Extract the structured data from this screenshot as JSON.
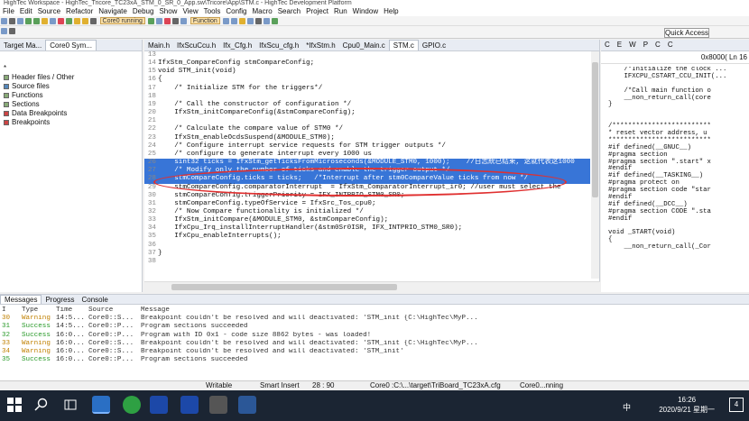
{
  "window": {
    "title": "HighTec Workspace - HighTec_Tricore_TC23xA_STM_0_SR_0_App.sw\\Tricore\\App\\STM.c - HighTec Development Platform"
  },
  "menu": [
    "File",
    "Edit",
    "Source",
    "Refactor",
    "Navigate",
    "Debug",
    "Show",
    "View",
    "Tools",
    "Config",
    "Macro",
    "Search",
    "Project",
    "Run",
    "Window",
    "Help"
  ],
  "toolbar": {
    "run_state": "Core0 running",
    "function_label": "Function"
  },
  "quick_access": "Quick Access",
  "left": {
    "tabs": [
      "Target Ma...",
      "Core0 Sym..."
    ],
    "root": "*",
    "items": [
      "Header files / Other",
      "Source files",
      "Functions",
      "Sections",
      "Data Breakpoints",
      "Breakpoints"
    ]
  },
  "editor": {
    "tabs": [
      "Main.h",
      "IfxScuCcu.h",
      "Ifx_Cfg.h",
      "IfxScu_cfg.h",
      "*IfxStm.h",
      "Cpu0_Main.c",
      "STM.c",
      "GPIO.c"
    ],
    "lines": [
      {
        "n": "13",
        "t": ""
      },
      {
        "n": "14",
        "t": "IfxStm_CompareConfig stmCompareConfig;"
      },
      {
        "n": "15",
        "t": "void STM_init(void)"
      },
      {
        "n": "16",
        "t": "{"
      },
      {
        "n": "17",
        "t": "    /* Initialize STM for the triggers*/"
      },
      {
        "n": "18",
        "t": ""
      },
      {
        "n": "19",
        "t": "    /* Call the constructor of configuration */"
      },
      {
        "n": "20",
        "t": "    IfxStm_initCompareConfig(&stmCompareConfig);"
      },
      {
        "n": "21",
        "t": ""
      },
      {
        "n": "22",
        "t": "    /* Calculate the compare value of STM0 */"
      },
      {
        "n": "23",
        "t": "    IfxStm_enableOcdsSuspend(&MODULE_STM0);"
      },
      {
        "n": "24",
        "t": "    /* Configure interrupt service requests for STM trigger outputs */"
      },
      {
        "n": "25",
        "t": "    /* configure to generate interrupt every 1000 us"
      },
      {
        "n": "26",
        "t": "    sint32 ticks = IfxStm_getTicksFromMicroseconds(&MODULE_STM0, 1000);    //日志統已结束, 这就代表这1000"
      },
      {
        "n": "27",
        "t": "    /* Modify only the number of ticks and enable the trigger output */"
      },
      {
        "n": "28",
        "t": "    stmCompareConfig.ticks = ticks;   /*Interrupt after stm0CompareValue ticks from now */"
      },
      {
        "n": "29",
        "t": "    stmCompareConfig.comparatorInterrupt  = IfxStm_ComparatorInterrupt_ir0; //user must select the"
      },
      {
        "n": "30",
        "t": "    stmCompareConfig.triggerPriority = IFX_INTPRIO_STM0_SR0;"
      },
      {
        "n": "31",
        "t": "    stmCompareConfig.typeOfService = IfxSrc_Tos_cpu0;"
      },
      {
        "n": "32",
        "t": "    /* Now Compare functionality is initialized */"
      },
      {
        "n": "33",
        "t": "    IfxStm_initCompare(&MODULE_STM0, &stmCompareConfig);"
      },
      {
        "n": "34",
        "t": "    IfxCpu_Irq_installInterruptHandler(&stm0Sr0ISR, IFX_INTPRIO_STM0_SR0);"
      },
      {
        "n": "35",
        "t": "    IfxCpu_enableInterrupts();"
      },
      {
        "n": "36",
        "t": ""
      },
      {
        "n": "37",
        "t": "}"
      },
      {
        "n": "38",
        "t": ""
      }
    ]
  },
  "right": {
    "tabs": [
      "C",
      "E",
      "W",
      "P",
      "C",
      "C"
    ],
    "address": "0x8000( Ln 16",
    "lines": [
      "    /*Initialize the clock ...",
      "    IFXCPU_CSTART_CCU_INIT(...",
      "",
      "    /*Call main function o",
      "    __non_return_call(core",
      "}",
      "",
      "",
      "/*************************",
      "* reset vector address, u",
      "**************************",
      "#if defined(__GNUC__)",
      "#pragma section",
      "#pragma section \".start\" x",
      "#endif",
      "#if defined(__TASKING__)",
      "#pragma protect on",
      "#pragma section code \"star",
      "#endif",
      "#if defined(__DCC__)",
      "#pragma section CODE \".sta",
      "#endif",
      "",
      "void _START(void)",
      "{",
      "    __non_return_call(_Cor"
    ]
  },
  "messages": {
    "tabs": [
      "Messages",
      "Progress",
      "Console"
    ],
    "headers": [
      "I",
      "Type",
      "Time",
      "Source",
      "Message"
    ],
    "rows": [
      {
        "i": "30",
        "type": "Warning",
        "time": "14:5...",
        "src": "Core0::S...",
        "msg": "Breakpoint couldn't be resolved and will deactivated: 'STM_init {C:\\HighTec\\MyP..."
      },
      {
        "i": "31",
        "type": "Success",
        "time": "14:5...",
        "src": "Core0::P...",
        "msg": "Program sections succeeded"
      },
      {
        "i": "32",
        "type": "Success",
        "time": "16:0...",
        "src": "Core0::P...",
        "msg": "Program with ID 0x1 - code size 8862 bytes - was loaded!"
      },
      {
        "i": "33",
        "type": "Warning",
        "time": "16:0...",
        "src": "Core0::S...",
        "msg": "Breakpoint couldn't be resolved and will deactivated: 'STM_init {C:\\HighTec\\MyP..."
      },
      {
        "i": "34",
        "type": "Warning",
        "time": "16:0...",
        "src": "Core0::S...",
        "msg": "Breakpoint couldn't be resolved and will deactivated: 'STM_init'"
      },
      {
        "i": "35",
        "type": "Success",
        "time": "16:0...",
        "src": "Core0::P...",
        "msg": "Program sections succeeded"
      }
    ]
  },
  "status": {
    "mode": "Writable",
    "insert": "Smart Insert",
    "pos": "28 : 90",
    "target": "Core0 :C:\\...\\target\\TriBoard_TC23xA.cfg",
    "core": "Core0...nning"
  },
  "taskbar": {
    "time": "16:26",
    "date": "2020/9/21 星期一",
    "ime": "中",
    "notif": "4"
  }
}
